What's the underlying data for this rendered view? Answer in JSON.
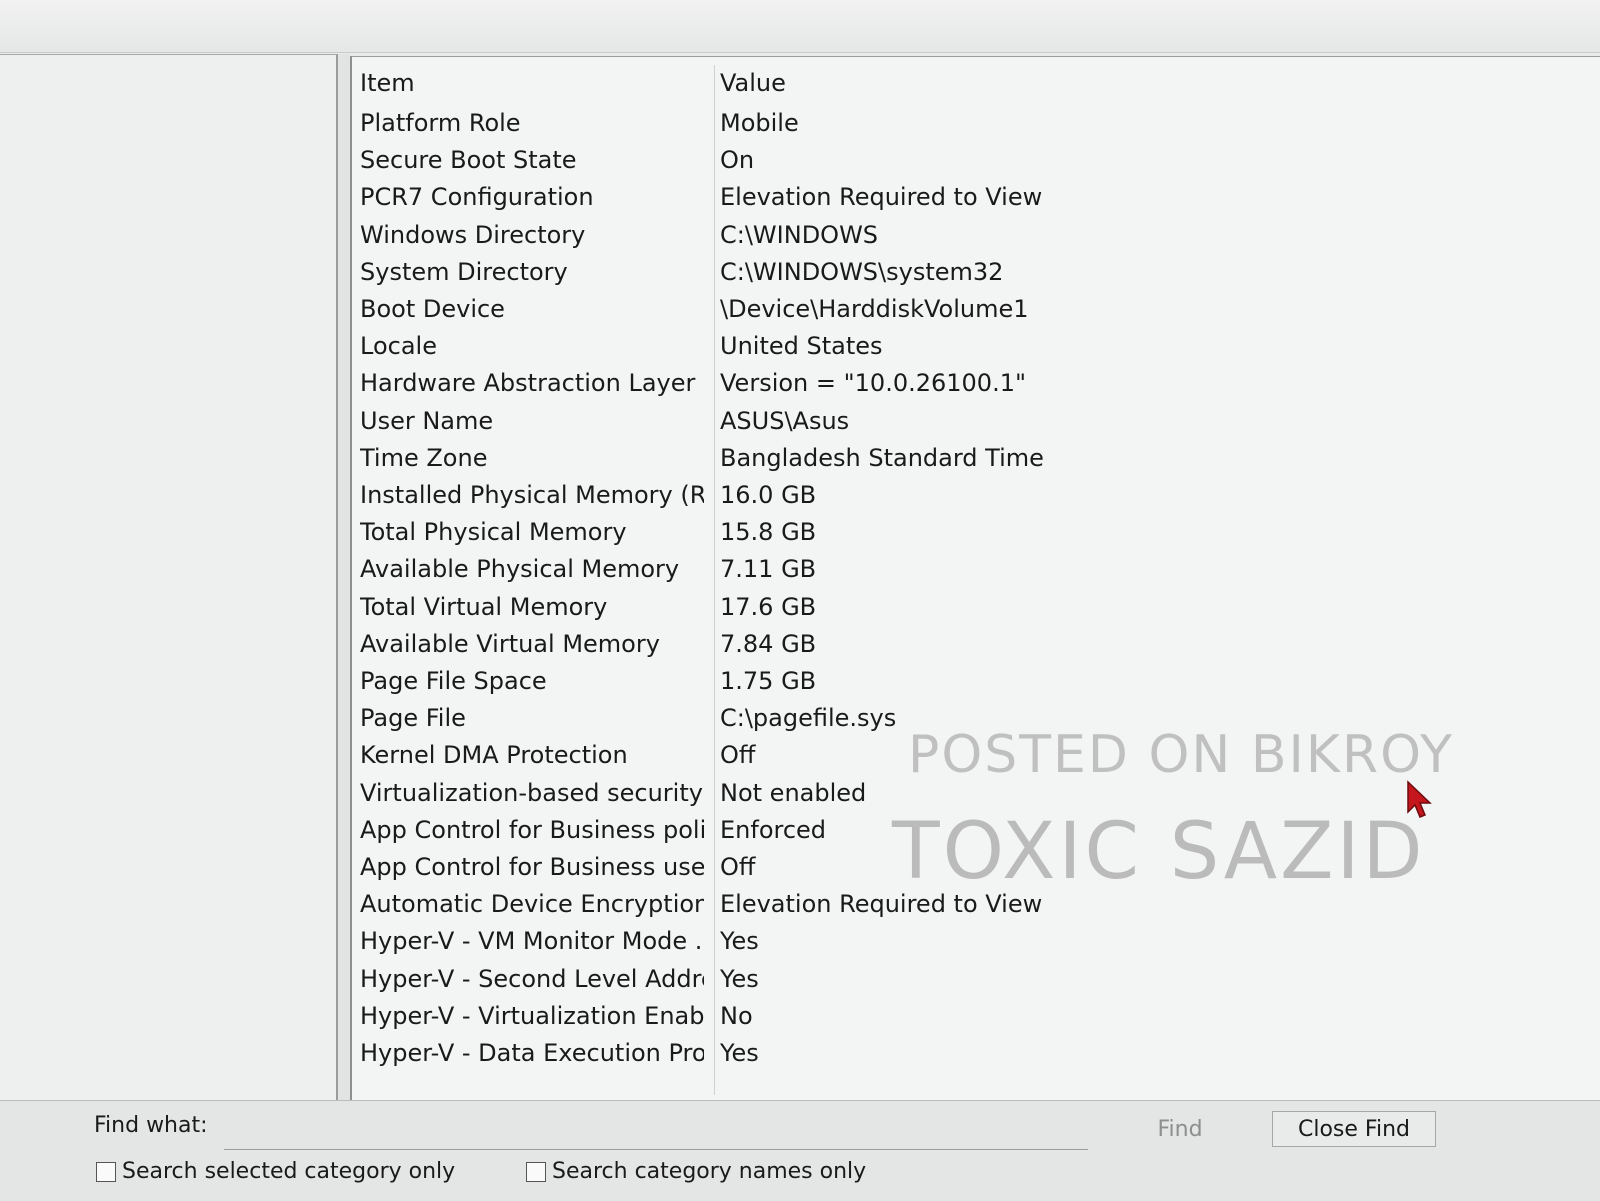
{
  "table": {
    "header": {
      "item": "Item",
      "value": "Value"
    },
    "rows": [
      {
        "item": "Platform Role",
        "value": "Mobile"
      },
      {
        "item": "Secure Boot State",
        "value": "On"
      },
      {
        "item": "PCR7 Configuration",
        "value": "Elevation Required to View"
      },
      {
        "item": "Windows Directory",
        "value": "C:\\WINDOWS"
      },
      {
        "item": "System Directory",
        "value": "C:\\WINDOWS\\system32"
      },
      {
        "item": "Boot Device",
        "value": "\\Device\\HarddiskVolume1"
      },
      {
        "item": "Locale",
        "value": "United States"
      },
      {
        "item": "Hardware Abstraction Layer",
        "value": "Version = \"10.0.26100.1\""
      },
      {
        "item": "User Name",
        "value": "ASUS\\Asus"
      },
      {
        "item": "Time Zone",
        "value": "Bangladesh Standard Time"
      },
      {
        "item": "Installed Physical Memory (RA...",
        "value": "16.0 GB"
      },
      {
        "item": "Total Physical Memory",
        "value": "15.8 GB"
      },
      {
        "item": "Available Physical Memory",
        "value": "7.11 GB"
      },
      {
        "item": "Total Virtual Memory",
        "value": "17.6 GB"
      },
      {
        "item": "Available Virtual Memory",
        "value": "7.84 GB"
      },
      {
        "item": "Page File Space",
        "value": "1.75 GB"
      },
      {
        "item": "Page File",
        "value": "C:\\pagefile.sys"
      },
      {
        "item": "Kernel DMA Protection",
        "value": "Off"
      },
      {
        "item": "Virtualization-based security",
        "value": "Not enabled"
      },
      {
        "item": "App Control for Business policy",
        "value": "Enforced"
      },
      {
        "item": "App Control for Business user ...",
        "value": "Off"
      },
      {
        "item": "Automatic Device Encryption ...",
        "value": "Elevation Required to View"
      },
      {
        "item": "Hyper-V - VM Monitor Mode ...",
        "value": "Yes"
      },
      {
        "item": "Hyper-V - Second Level Addre...",
        "value": "Yes"
      },
      {
        "item": "Hyper-V - Virtualization Enabl...",
        "value": "No"
      },
      {
        "item": "Hyper-V - Data Execution Pro...",
        "value": "Yes"
      }
    ]
  },
  "watermark": {
    "line1": "POSTED ON BIKROY",
    "line2": "TOXIC SAZID"
  },
  "find_bar": {
    "label": "Find what:",
    "input_value": "",
    "find_button": "Find",
    "close_button": "Close Find",
    "checkbox_category": {
      "label": "Search selected category only",
      "checked": false
    },
    "checkbox_names": {
      "label": "Search category names only",
      "checked": false
    }
  },
  "icons": {
    "cursor": "mouse-pointer-icon"
  },
  "colors": {
    "cursor": "#c4161c"
  }
}
